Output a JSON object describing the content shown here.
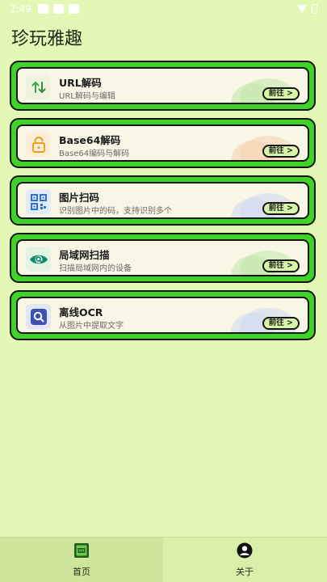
{
  "status_bar": {
    "time": "2:49"
  },
  "page": {
    "title": "珍玩雅趣"
  },
  "cards": [
    {
      "title": "URL解码",
      "desc": "URL解码与编辑",
      "button": "前往 >",
      "icon": "swap-arrows-icon",
      "blob_color": "#bfe8a8"
    },
    {
      "title": "Base64解码",
      "desc": "Base64编码与解码",
      "button": "前往 >",
      "icon": "lock-icon",
      "blob_color": "#f6d2b0"
    },
    {
      "title": "图片扫码",
      "desc": "识别图片中的码，支持识别多个",
      "button": "前往 >",
      "icon": "qr-code-icon",
      "blob_color": "#cfd7f2"
    },
    {
      "title": "局域网扫描",
      "desc": "扫描局域网内的设备",
      "button": "前往 >",
      "icon": "eye-scan-icon",
      "blob_color": "#bfe8a8"
    },
    {
      "title": "离线OCR",
      "desc": "从图片中提取文字",
      "button": "前往 >",
      "icon": "search-image-icon",
      "blob_color": "#cfd7f2"
    }
  ],
  "bottom_nav": {
    "items": [
      {
        "label": "首页",
        "icon": "home-icon",
        "active": true
      },
      {
        "label": "关于",
        "icon": "person-icon",
        "active": false
      }
    ]
  }
}
